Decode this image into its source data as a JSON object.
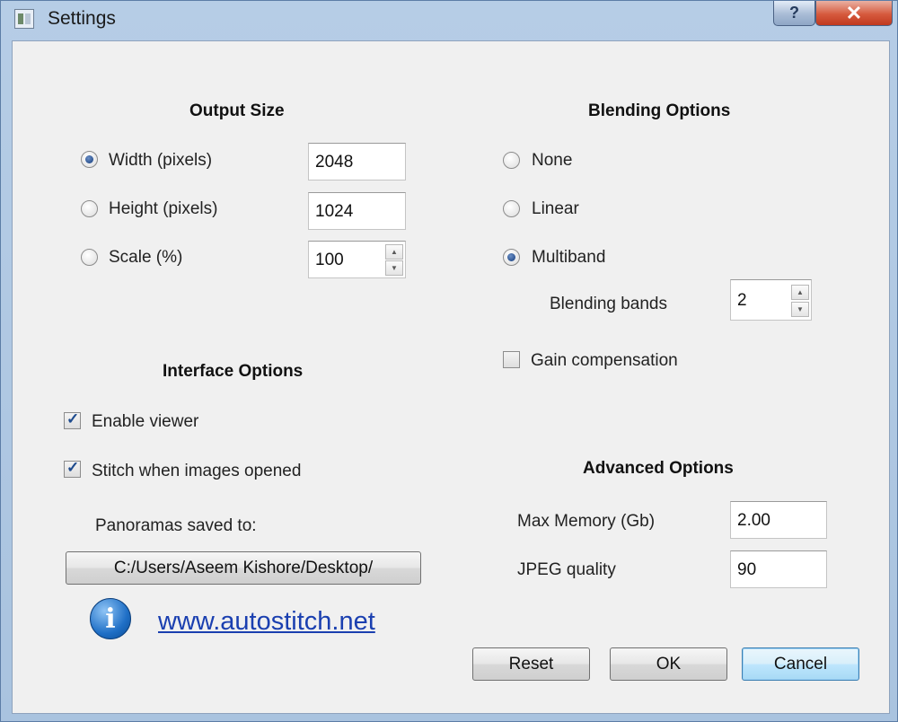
{
  "window": {
    "title": "Settings",
    "help_label": "?",
    "close_label": "✕"
  },
  "output_size": {
    "title": "Output Size",
    "options": [
      {
        "label": "Width (pixels)",
        "value": "2048",
        "selected": true
      },
      {
        "label": "Height (pixels)",
        "value": "1024",
        "selected": false
      },
      {
        "label": "Scale (%)",
        "value": "100",
        "selected": false
      }
    ]
  },
  "blending": {
    "title": "Blending Options",
    "options": [
      {
        "label": "None",
        "selected": false
      },
      {
        "label": "Linear",
        "selected": false
      },
      {
        "label": "Multiband",
        "selected": true
      }
    ],
    "bands_label": "Blending bands",
    "bands_value": "2",
    "gain_label": "Gain compensation",
    "gain_checked": false
  },
  "interface": {
    "title": "Interface Options",
    "enable_viewer_label": "Enable viewer",
    "enable_viewer_checked": true,
    "stitch_label": "Stitch when images opened",
    "stitch_checked": true,
    "saved_to_label": "Panoramas saved to:",
    "path_button": "C:/Users/Aseem Kishore/Desktop/"
  },
  "advanced": {
    "title": "Advanced Options",
    "max_memory_label": "Max Memory (Gb)",
    "max_memory_value": "2.00",
    "jpeg_label": "JPEG quality",
    "jpeg_value": "90"
  },
  "footer": {
    "info_icon_glyph": "i",
    "link_text": "www.autostitch.net",
    "reset_label": "Reset",
    "ok_label": "OK",
    "cancel_label": "Cancel"
  },
  "icons": {
    "app": "app-icon",
    "info": "info-icon",
    "help": "help-icon",
    "close": "close-icon"
  }
}
